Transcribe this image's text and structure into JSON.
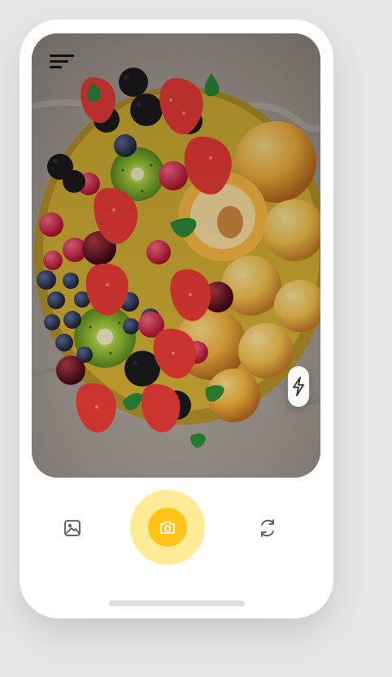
{
  "app": {
    "title": ""
  },
  "camera": {
    "photo_subject": "fruit platter",
    "accent_color": "#ffc31a",
    "accent_soft_color": "#ffeb96"
  },
  "icons": {
    "menu": "menu-lines-icon",
    "flash": "flash-icon",
    "gallery": "image-gallery-icon",
    "shutter": "camera-icon",
    "flip": "switch-camera-icon"
  }
}
